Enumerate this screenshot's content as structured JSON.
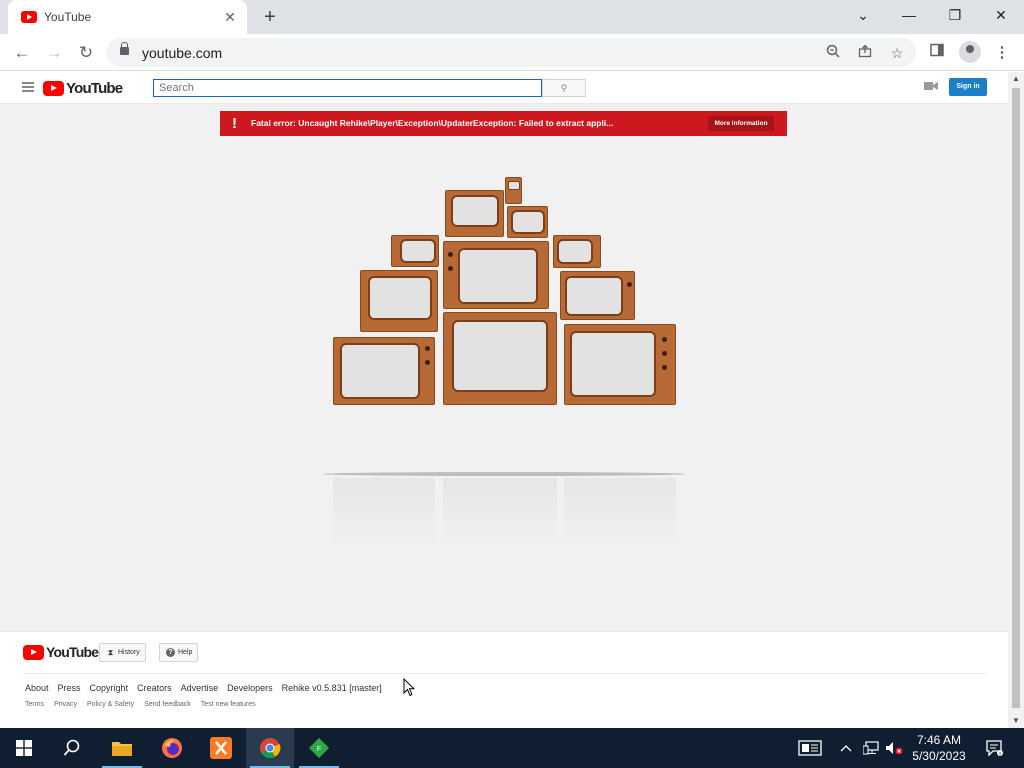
{
  "browser": {
    "tab_title": "YouTube",
    "tab_close": "✕",
    "new_tab": "+",
    "url": "youtube.com",
    "controls": {
      "chevron": "⌄",
      "minimize": "—",
      "restore": "❐",
      "close": "✕"
    },
    "nav": {
      "back": "←",
      "forward": "→",
      "reload": "↻"
    },
    "toolbar_icons": [
      "zoom-icon",
      "share-icon",
      "star-icon",
      "sidepanel-icon",
      "profile-icon",
      "menu-icon"
    ]
  },
  "masthead": {
    "logo_word": "YouTube",
    "search_placeholder": "Search",
    "search_button_icon": "⚲",
    "sign_in": "Sign in",
    "upload_icon": "upload-icon"
  },
  "error": {
    "icon": "!",
    "message": "Fatal error: Uncaught Rehike\\Player\\Exception\\UpdaterException: Failed to extract appli...",
    "more_info": "More information"
  },
  "footer": {
    "logo_word": "YouTube",
    "history": "History",
    "help": "Help",
    "primary_links": [
      "About",
      "Press",
      "Copyright",
      "Creators",
      "Advertise",
      "Developers",
      "Rehike v0.5.831 [master]"
    ],
    "secondary_links": [
      "Terms",
      "Privacy",
      "Policy & Safety",
      "Send feedback",
      "Test new features"
    ]
  },
  "taskbar": {
    "apps": [
      "start-icon",
      "search-icon",
      "file-explorer-icon",
      "firefox-icon",
      "xampp-icon",
      "chrome-icon",
      "fiddler-icon"
    ],
    "time": "7:46 AM",
    "date": "5/30/2023"
  },
  "colors": {
    "yt_red": "#ff0000",
    "error_red": "#cc181e",
    "signin_blue": "#1b7fcc",
    "taskbar": "#0f1e30"
  }
}
